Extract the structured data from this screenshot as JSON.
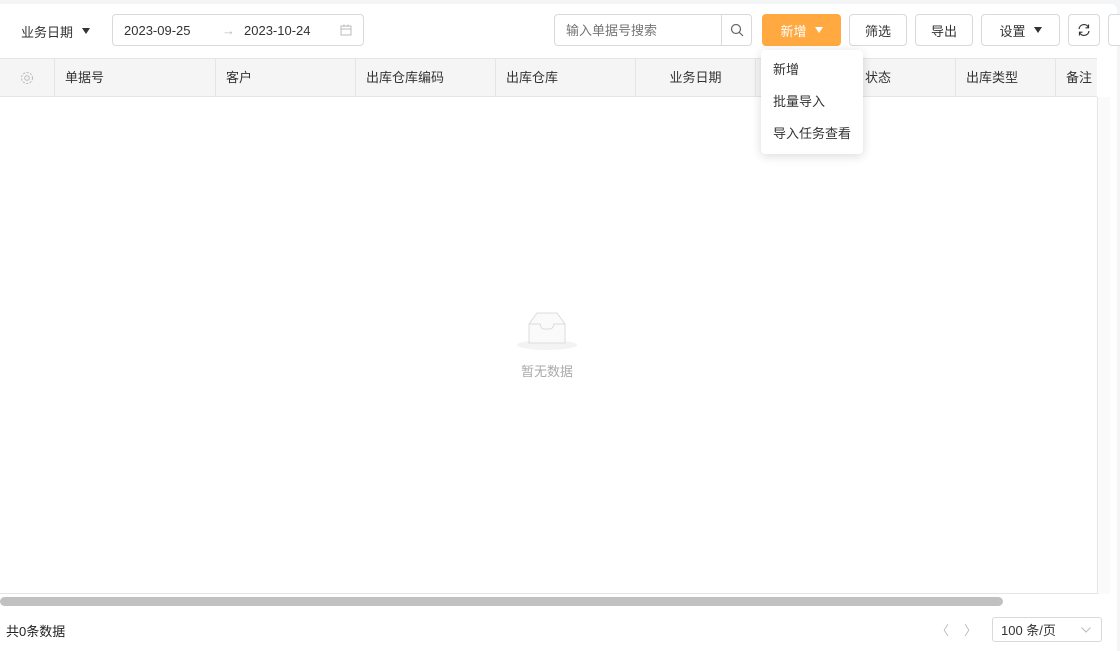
{
  "toolbar": {
    "date_type": "业务日期",
    "date_start": "2023-09-25",
    "date_end": "2023-10-24",
    "search_placeholder": "输入单据号搜索",
    "add_label": "新增",
    "filter_label": "筛选",
    "export_label": "导出",
    "settings_label": "设置",
    "accent": "#ffa940"
  },
  "add_menu": {
    "items": [
      {
        "label": "新增"
      },
      {
        "label": "批量导入"
      },
      {
        "label": "导入任务查看"
      }
    ]
  },
  "table": {
    "columns": [
      {
        "label": "单据号"
      },
      {
        "label": "客户"
      },
      {
        "label": "出库仓库编码"
      },
      {
        "label": "出库仓库"
      },
      {
        "label": "业务日期"
      },
      {
        "label": "状态"
      },
      {
        "label": "出库类型"
      },
      {
        "label": "备注"
      }
    ],
    "empty_text": "暂无数据"
  },
  "footer": {
    "total": "共0条数据",
    "page_size": "100 条/页"
  }
}
